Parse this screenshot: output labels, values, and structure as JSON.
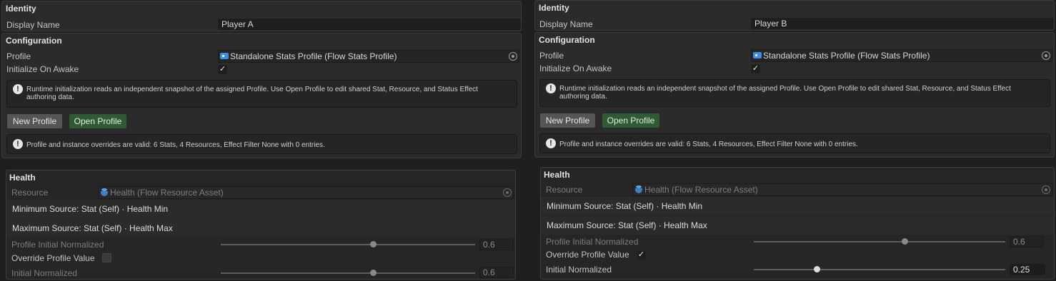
{
  "left": {
    "identity_title": "Identity",
    "display_name_label": "Display Name",
    "display_name_value": "Player A",
    "configuration_title": "Configuration",
    "profile_label": "Profile",
    "profile_value": "Standalone Stats Profile (Flow Stats Profile)",
    "profile_icon": "scriptable-object-icon",
    "initialize_label": "Initialize On Awake",
    "initialize_checked": "✓",
    "help_info_line1": "Runtime initialization reads an independent snapshot of the assigned Profile. Use Open Profile to edit shared Stat, Resource, and Status Effect",
    "help_info_line2": "authoring data.",
    "new_profile_label": "New Profile",
    "open_profile_label": "Open Profile",
    "help_valid": "Profile and instance overrides are valid: 6 Stats, 4 Resources, Effect Filter None with 0 entries.",
    "health": {
      "title": "Health",
      "resource_label": "Resource",
      "resource_value": "Health (Flow Resource Asset)",
      "min_source": "Minimum Source: Stat (Self) · Health Min",
      "max_source": "Maximum Source: Stat (Self) · Health Max",
      "profile_initial_label": "Profile Initial Normalized",
      "profile_initial_value": "0.6",
      "profile_initial_fraction": 0.6,
      "override_label": "Override Profile Value",
      "override_checked": "",
      "initial_label": "Initial Normalized",
      "initial_value": "0.6",
      "initial_fraction": 0.6
    }
  },
  "right": {
    "identity_title": "Identity",
    "display_name_label": "Display Name",
    "display_name_value": "Player B",
    "configuration_title": "Configuration",
    "profile_label": "Profile",
    "profile_value": "Standalone Stats Profile (Flow Stats Profile)",
    "profile_icon": "scriptable-object-icon",
    "initialize_label": "Initialize On Awake",
    "initialize_checked": "✓",
    "help_info_line1": "Runtime initialization reads an independent snapshot of the assigned Profile. Use Open Profile to edit shared Stat, Resource, and Status Effect",
    "help_info_line2": "authoring data.",
    "new_profile_label": "New Profile",
    "open_profile_label": "Open Profile",
    "help_valid": "Profile and instance overrides are valid: 6 Stats, 4 Resources, Effect Filter None with 0 entries.",
    "health": {
      "title": "Health",
      "resource_label": "Resource",
      "resource_value": "Health (Flow Resource Asset)",
      "min_source": "Minimum Source: Stat (Self) · Health Min",
      "max_source": "Maximum Source: Stat (Self) · Health Max",
      "profile_initial_label": "Profile Initial Normalized",
      "profile_initial_value": "0.6",
      "profile_initial_fraction": 0.6,
      "override_label": "Override Profile Value",
      "override_checked": "✓",
      "initial_label": "Initial Normalized",
      "initial_value": "0.25",
      "initial_fraction": 0.25
    }
  },
  "colors": {
    "background": "#1f1f1f",
    "panel": "#2b2b2b",
    "button_grey": "#555555",
    "button_green": "#2f5a33",
    "object_icon": "#3c8fe0"
  }
}
